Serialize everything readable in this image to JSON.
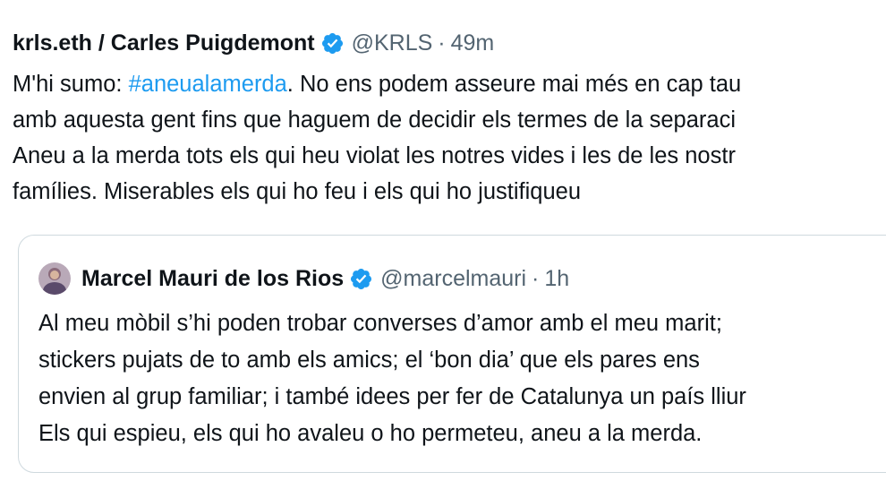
{
  "tweet": {
    "author_name": "krls.eth / Carles Puigdemont",
    "handle": "@KRLS",
    "separator": "·",
    "time": "49m",
    "verified_icon": "verified-badge-icon",
    "body": {
      "line1_prefix": "M'hi sumo: ",
      "hashtag": "#aneualamerda",
      "line1_suffix": ". No ens podem asseure mai més en cap tau",
      "line2": "amb aquesta gent fins que haguem de decidir els termes de la separaci",
      "line3": "Aneu a la merda tots els qui heu violat les notres vides i les de les nostr",
      "line4": "famílies. Miserables els qui ho feu i els qui ho justifiqueu"
    }
  },
  "quoted_tweet": {
    "author_name": "Marcel Mauri de los Rios",
    "handle": "@marcelmauri",
    "separator": "·",
    "time": "1h",
    "avatar_icon": "avatar",
    "verified_icon": "verified-badge-icon",
    "body": {
      "line1": "Al meu mòbil s’hi poden trobar converses d’amor amb el meu marit;",
      "line2": "stickers pujats de to amb els amics; el ‘bon dia’ que els pares ens",
      "line3": "envien al grup familiar; i també idees per fer de Catalunya un país lliur",
      "line4": "Els qui espieu, els qui ho avaleu o ho permeteu, aneu a la merda."
    }
  },
  "colors": {
    "text": "#0f1419",
    "secondary": "#536471",
    "link": "#1d9bf0",
    "verified": "#1d9bf0",
    "border": "#cfd9de"
  }
}
